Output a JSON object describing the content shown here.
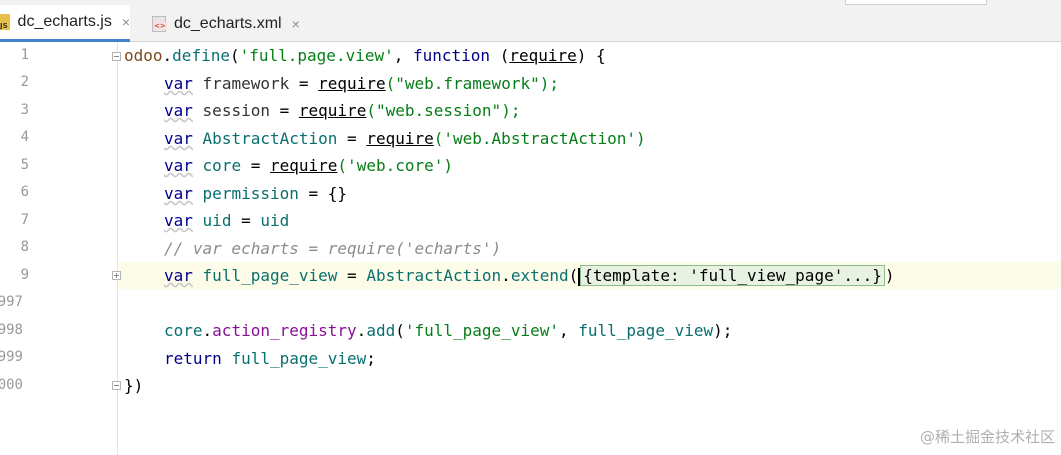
{
  "tabs": [
    {
      "label": "dc_echarts.js",
      "icon": "js-file-icon",
      "icon_text": "JS",
      "active": true
    },
    {
      "label": "dc_echarts.xml",
      "icon": "xml-file-icon",
      "icon_text": "<>",
      "active": false
    }
  ],
  "close_glyph": "×",
  "line_numbers": [
    "1",
    "2",
    "3",
    "4",
    "5",
    "6",
    "7",
    "8",
    "9",
    "997",
    "998",
    "999",
    "000"
  ],
  "code": {
    "l1": {
      "t1": "odoo",
      "t2": ".",
      "t3": "define",
      "t4": "(",
      "t5": "'full.page.view'",
      "t6": ", ",
      "t7": "function",
      "t8": " (",
      "t9": "require",
      "t10": ") {"
    },
    "l2": {
      "kw": "var",
      "name": "framework",
      "eq": " = ",
      "req": "require",
      "s": "(\"web.framework\");"
    },
    "l3": {
      "kw": "var",
      "name": "session",
      "eq": " = ",
      "req": "require",
      "s": "(\"web.session\");"
    },
    "l4": {
      "kw": "var",
      "name": "AbstractAction",
      "eq": " = ",
      "req": "require",
      "s": "('web.AbstractAction')"
    },
    "l5": {
      "kw": "var",
      "name": "core",
      "eq": " = ",
      "req": "require",
      "s": "('web.core')"
    },
    "l6": {
      "kw": "var",
      "name": "permission",
      "rest": " = {}"
    },
    "l7": {
      "kw": "var",
      "name": "uid",
      "eq": " = ",
      "val": "uid"
    },
    "l8": {
      "comment": "// var echarts = require('echarts')"
    },
    "l9": {
      "kw": "var",
      "name": "full_page_view",
      "eq": " = ",
      "obj": "AbstractAction",
      "dot": ".",
      "fn": "extend",
      "open": "(",
      "collapsed": "{template: 'full_view_page'...}",
      "close": ")"
    },
    "l11": {
      "obj": "core",
      "dot1": ".",
      "prop": "action_registry",
      "dot2": ".",
      "fn": "add",
      "open": "(",
      "str": "'full_page_view'",
      "comma": ", ",
      "arg": "full_page_view",
      "close": ");"
    },
    "l12": {
      "kw": "return",
      "val": "full_page_view",
      "end": ";"
    },
    "l13": {
      "end": "})"
    }
  },
  "watermark": "@稀土掘金技术社区"
}
